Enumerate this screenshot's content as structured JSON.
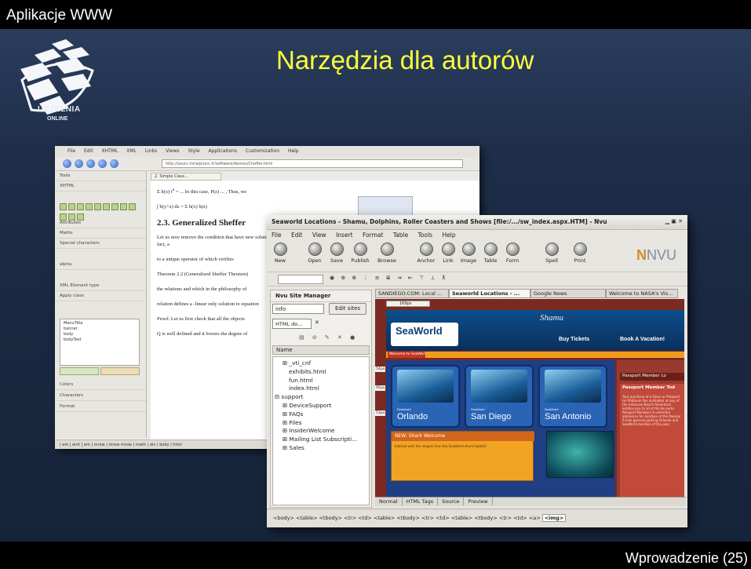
{
  "slide": {
    "app_name": "Aplikacje WWW",
    "title": "Narzędzia dla autorów",
    "logo_text": "UCZELNIA",
    "logo_subtext": "ONLINE",
    "footer": "Wprowadzenie (25)"
  },
  "back_editor": {
    "menus": [
      "File",
      "Edit",
      "XHTML",
      "XML",
      "Links",
      "Views",
      "Style",
      "Applications",
      "Customization",
      "Help"
    ],
    "url": "http://sourc.inria/plunc.fr/software/demos/Cheffer.html",
    "tab": "2. Simple Class...",
    "side_rows": [
      "Tools",
      "XHTML",
      "Attributes",
      "Maths",
      "Special characters",
      "alpha",
      "XML Element type",
      "Apply class",
      "Colors",
      "Characters",
      "Format"
    ],
    "class_list": [
      "MenuTitle",
      "banner",
      "body",
      "bodyText"
    ],
    "heading": "2.3. Generalized Sheffer",
    "paragraphs": [
      "Let us now remove the condition that  have new solutions to equation. In fact, a",
      "to a unique operator of  which verifies",
      "Theorem 2.2 (Generalized Sheffer Theorem)",
      "the relations  and  which in the philosophy of",
      "relation  defines a  -linear only solution  to equation",
      "Proof: Let us first check that all the objects",
      "Q is well defined and it lowers the degree of"
    ],
    "status": "| em | emt | em | mrow | mrow mrow | math | div | body | html"
  },
  "nvu": {
    "window_title": "Seaworld Locations - Shamu, Dolphins, Roller Coasters and Shows [file:/.../sw_index.aspx.HTM] - Nvu",
    "menus": [
      "File",
      "Edit",
      "View",
      "Insert",
      "Format",
      "Table",
      "Tools",
      "Help"
    ],
    "toolbar": [
      "New",
      "Open",
      "Save",
      "Publish",
      "Browse",
      "Anchor",
      "Link",
      "Image",
      "Table",
      "Form",
      "Spell",
      "Print"
    ],
    "logo": "NVU",
    "site_manager": {
      "title": "Nvu Site Manager",
      "site": "info",
      "edit_sites": "Edit sites",
      "file_type": "HTML do...",
      "name_header": "Name",
      "tree": [
        {
          "label": "⊞ _vti_cnf",
          "level": 1
        },
        {
          "label": "exhibits.html",
          "level": 2
        },
        {
          "label": "fun.html",
          "level": 2
        },
        {
          "label": "index.html",
          "level": 2
        },
        {
          "label": "⊟ support",
          "level": 0
        },
        {
          "label": "⊞ DeviceSupport",
          "level": 1
        },
        {
          "label": "⊞ FAQs",
          "level": 1
        },
        {
          "label": "⊞ Files",
          "level": 1
        },
        {
          "label": "⊞ InsiderWelcome",
          "level": 1
        },
        {
          "label": "⊞ Mailing List Subscripti...",
          "level": 1
        },
        {
          "label": "⊞ Sales",
          "level": 1
        }
      ]
    },
    "tabs": [
      "SANDIEGO.COM: Local ...",
      "Seaworld Locations - ...",
      "Google News",
      "Welcome to NASA's Vis..."
    ],
    "page": {
      "logo": "SeaWorld",
      "shamu": "Shamu",
      "nav": [
        "Buy Tickets",
        "Book A Vacation!"
      ],
      "welcome": "Welcome to SeaWorld",
      "brand": "SeaWorld",
      "cities": [
        "Orlando",
        "San Diego",
        "San Antonio"
      ],
      "shark_title": "NEW: Shark Welcome",
      "shark_text": "Interact with the images from the SeaWorld shark habitat!",
      "pp_header": "Passport Member Lo",
      "pp_title": "Passport Member Tod",
      "pp_text": "Your purchase of a Silver or Passport (or Platinum Pas available) at any of the Anheuser-Busch Adventure entitles you to all of the be perks Passport Members A unlimited admission for duration of the Passpor A Free general parking Orlando and SeaWorld duration of the pass",
      "ruler_label": "169px",
      "side_labels": [
        "54px",
        "95px",
        "53px"
      ]
    },
    "modes": [
      "Normal",
      "HTML Tags",
      "Source",
      "Preview"
    ],
    "tag_path": [
      "<body>",
      "<table>",
      "<tbody>",
      "<tr>",
      "<td>",
      "<table>",
      "<tbody>",
      "<tr>",
      "<td>",
      "<table>",
      "<tbody>",
      "<tr>",
      "<td>",
      "<a>",
      "<img>"
    ]
  }
}
